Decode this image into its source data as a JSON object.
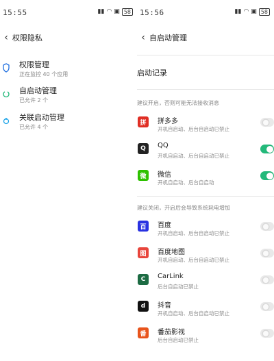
{
  "colors": {
    "accent": "#23b97a",
    "toggle_off": "#e9e9e9",
    "subtext": "#888888"
  },
  "left": {
    "status": {
      "time": "15:55",
      "icons": [
        "signal-icon",
        "wifi-icon",
        "notification-icon",
        "battery-icon"
      ],
      "battery": "58"
    },
    "header": {
      "back": "‹",
      "title": "权限隐私"
    },
    "items": [
      {
        "title": "权限管理",
        "subtitle": "正在监控 40 个应用",
        "icon": "shield-icon",
        "color": "#1f6fe0"
      },
      {
        "title": "自启动管理",
        "subtitle": "已允许 2 个",
        "icon": "power-icon",
        "color": "#23b97a"
      },
      {
        "title": "关联启动管理",
        "subtitle": "已允许 4 个",
        "icon": "link-icon",
        "color": "#1aa3e8"
      }
    ]
  },
  "right": {
    "status": {
      "time": "15:56",
      "icons": [
        "signal-icon",
        "wifi-icon",
        "notification-icon",
        "battery-icon"
      ],
      "battery": "58"
    },
    "header": {
      "back": "‹",
      "title": "自启动管理"
    },
    "record_heading": "启动记录",
    "note_allowed": "建议开启，否则可能无法接收消息",
    "note_disabled": "建议关闭，开启后会导致系统耗电增加",
    "apps_group1": [
      {
        "name": "拼多多",
        "subtitle": "开机自启动、后台自启动已禁止",
        "enabled": false,
        "icon": "pinduoduo-icon",
        "color": "#e02e24",
        "glyph": "拼"
      },
      {
        "name": "QQ",
        "subtitle": "开机自启动、后台自启动已禁止",
        "enabled": true,
        "icon": "qq-penguin-icon",
        "color": "#222222",
        "glyph": "Q"
      },
      {
        "name": "微信",
        "subtitle": "开机自启动、后台自启动",
        "enabled": true,
        "icon": "wechat-icon",
        "color": "#2dc100",
        "glyph": "微"
      }
    ],
    "apps_group2": [
      {
        "name": "百度",
        "subtitle": "开机自启动、后台自启动已禁止",
        "enabled": false,
        "icon": "baidu-paw-icon",
        "color": "#2932e1",
        "glyph": "百"
      },
      {
        "name": "百度地图",
        "subtitle": "开机自启动、后台自启动已禁止",
        "enabled": false,
        "icon": "baidu-map-icon",
        "color": "#e8453c",
        "glyph": "图"
      },
      {
        "name": "CarLink",
        "subtitle": "后台自启动已禁止",
        "enabled": false,
        "icon": "carlink-icon",
        "color": "#1c6b43",
        "glyph": "C"
      },
      {
        "name": "抖音",
        "subtitle": "开机自启动、后台自启动已禁止",
        "enabled": false,
        "icon": "douyin-icon",
        "color": "#111111",
        "glyph": "d"
      },
      {
        "name": "番茄影视",
        "subtitle": "后台自启动已禁止",
        "enabled": false,
        "icon": "tomato-icon",
        "color": "#e8541c",
        "glyph": "番"
      }
    ]
  }
}
